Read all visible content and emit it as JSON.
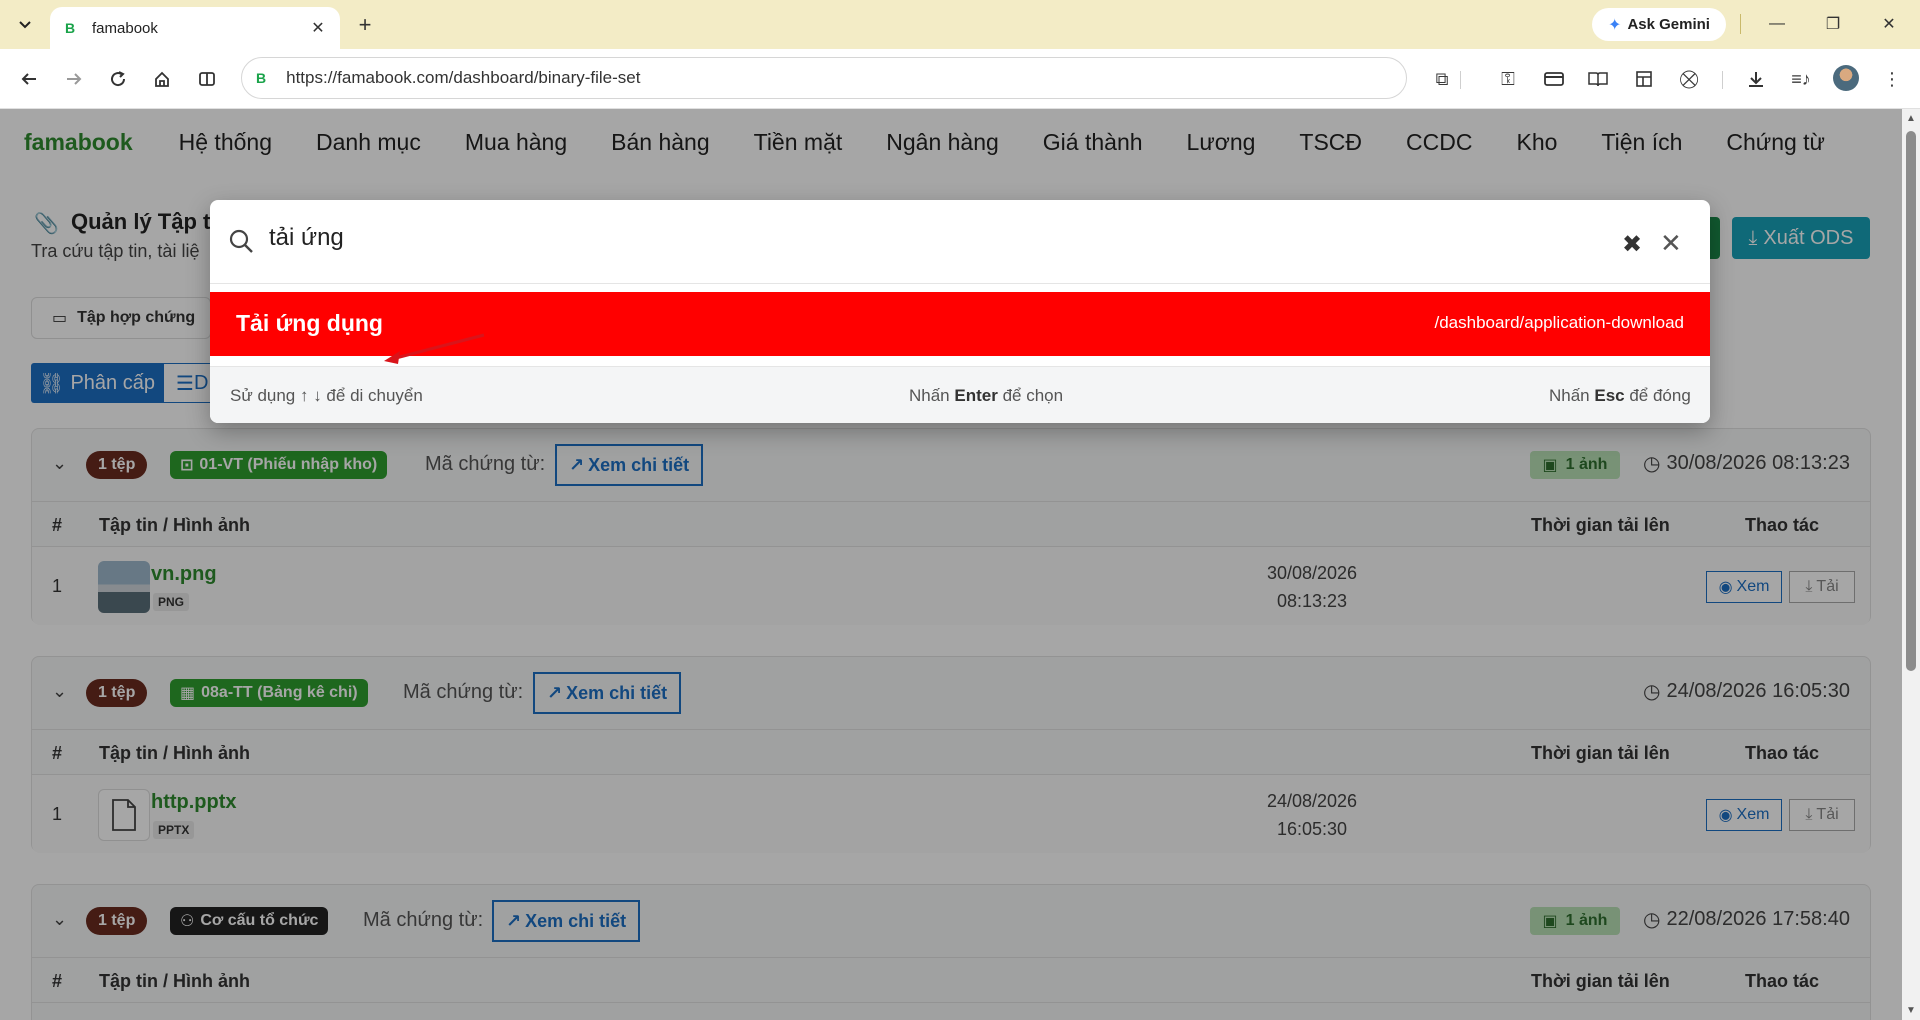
{
  "browser": {
    "tab_title": "famabook",
    "tab_favicon": "B",
    "url": "https://famabook.com/dashboard/binary-file-set",
    "gemini_label": "Ask Gemini"
  },
  "nav": {
    "brand": "famabook",
    "items": [
      "Hệ thống",
      "Danh mục",
      "Mua hàng",
      "Bán hàng",
      "Tiền mặt",
      "Ngân hàng",
      "Giá thành",
      "Lương",
      "TSCĐ",
      "CCDC",
      "Kho",
      "Tiện ích",
      "Chứng từ"
    ]
  },
  "page": {
    "title": "Quản lý Tập t",
    "subtitle": "Tra cứu tập tin, tài liệ",
    "export_label": "Xuất ODS",
    "filter_label": "Tập hợp chứng",
    "view_active": "Phân cấp",
    "view_other": "D"
  },
  "groups": [
    {
      "count": "1 tệp",
      "doc_badge": "01-VT (Phiếu nhập kho)",
      "doc_badge_color": "#2e9e2e",
      "doc_label": "Mã chứng từ:",
      "detail_label": "Xem chi tiết",
      "image_badge": "1 ảnh",
      "time": "30/08/2026 08:13:23",
      "headers": {
        "num": "#",
        "file": "Tập tin / Hình ảnh",
        "time": "Thời gian tải lên",
        "actions": "Thao tác"
      },
      "row": {
        "num": "1",
        "name": "vn.png",
        "ext": "PNG",
        "date": "30/08/2026",
        "clock": "08:13:23",
        "view": "Xem",
        "download": "Tải"
      }
    },
    {
      "count": "1 tệp",
      "doc_badge": "08a-TT (Bảng kê chi)",
      "doc_badge_color": "#2e9e2e",
      "doc_label": "Mã chứng từ:",
      "detail_label": "Xem chi tiết",
      "image_badge": "",
      "time": "24/08/2026 16:05:30",
      "headers": {
        "num": "#",
        "file": "Tập tin / Hình ảnh",
        "time": "Thời gian tải lên",
        "actions": "Thao tác"
      },
      "row": {
        "num": "1",
        "name": "http.pptx",
        "ext": "PPTX",
        "date": "24/08/2026",
        "clock": "16:05:30",
        "view": "Xem",
        "download": "Tải"
      }
    },
    {
      "count": "1 tệp",
      "doc_badge": "Cơ cấu tổ chức",
      "doc_badge_color": "#222222",
      "doc_label": "Mã chứng từ:",
      "detail_label": "Xem chi tiết",
      "image_badge": "1 ảnh",
      "time": "22/08/2026 17:58:40",
      "headers": {
        "num": "#",
        "file": "Tập tin / Hình ảnh",
        "time": "Thời gian tải lên",
        "actions": "Thao tác"
      }
    }
  ],
  "palette": {
    "query": "tải ứng",
    "result_title": "Tải ứng dụng",
    "result_path": "/dashboard/application-download",
    "hint_move_prefix": "Sử dụng ↑ ↓ để di chuyển",
    "hint_select_pre": "Nhấn ",
    "hint_select_key": "Enter",
    "hint_select_post": " để chọn",
    "hint_close_pre": "Nhấn ",
    "hint_close_key": "Esc",
    "hint_close_post": " để đóng"
  },
  "colors": {
    "accent_blue": "#1d6fc4",
    "brand_green": "#2e8b2e",
    "result_red": "#ff0000",
    "tabbar": "#f3ecc6"
  }
}
